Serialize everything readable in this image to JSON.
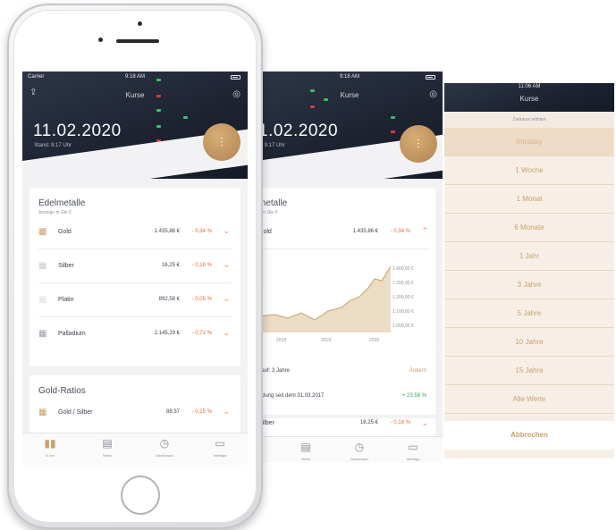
{
  "screen1": {
    "status": {
      "carrier": "Carrier",
      "time": "9:18 AM"
    },
    "header_title": "Kurse",
    "date": "11.02.2020",
    "time_label": "Stand: 9:17 Uhr",
    "cards": {
      "edelmetalle": {
        "title": "Edelmetalle",
        "subtitle": "Anzeige in Gkr €",
        "rows": [
          {
            "name": "Gold",
            "value": "1.435,86 €",
            "change": "- 0,34 %"
          },
          {
            "name": "Silber",
            "value": "16,25 €",
            "change": "- 0,18 %"
          },
          {
            "name": "Platin",
            "value": "892,58 €",
            "change": "- 0,05 %"
          },
          {
            "name": "Palladium",
            "value": "2.145,29 €",
            "change": "- 0,72 %"
          }
        ]
      },
      "ratios": {
        "title": "Gold-Ratios",
        "rows": [
          {
            "name": "Gold / Silber",
            "value": "88.37",
            "change": "- 0,15 %"
          }
        ]
      }
    },
    "tabs": [
      "Kurse",
      "News",
      "Dashboard",
      "Verträge"
    ]
  },
  "screen2": {
    "status": {
      "time": "9:18 AM"
    },
    "header_title": "Kurse",
    "date": "1.02.2020",
    "time_label": "d: 9:17 Uhr",
    "card_title": "metalle",
    "card_sub": "e in Gkr €",
    "row_gold": {
      "name": "Gold",
      "value": "1.435,86 €",
      "change": "- 0,34 %"
    },
    "chart_y_labels": [
      "1.400,00 €",
      "1.300,00 €",
      "1.200,00 €",
      "1.100,00 €",
      "1.000,00 €"
    ],
    "chart_x_labels": [
      "2018",
      "2019",
      "2020"
    ],
    "verlauf_label": "rlauf: 3 Jahre",
    "verlauf_action": "Ändern",
    "entw_label": "cklung seit dem 31.03.2017",
    "entw_value": "+ 23.58 %",
    "row_silber": {
      "name": "Silber",
      "value": "16,25 €",
      "change": "- 0,18 %"
    },
    "tabs": [
      "News",
      "Dashboard",
      "Verträge"
    ]
  },
  "screen3": {
    "status": {
      "time": "11:06 AM"
    },
    "header_title": "Kurse",
    "picker_title": "Zeitraum wählen",
    "options": [
      "Intraday",
      "1 Woche",
      "1 Monat",
      "6 Monate",
      "1 Jahr",
      "3 Jahre",
      "5 Jahre",
      "10 Jahre",
      "15 Jahre",
      "Alle Werte"
    ],
    "cancel": "Abbrechen"
  },
  "colors": {
    "accent": "#c8a06c",
    "negative": "#e56a2e",
    "positive": "#3aa55c",
    "header": "#1c2230"
  },
  "icons": {
    "share": "share-icon",
    "profile": "profile-icon",
    "filter": "sliders-icon",
    "chevron": "chevron-down-icon"
  }
}
